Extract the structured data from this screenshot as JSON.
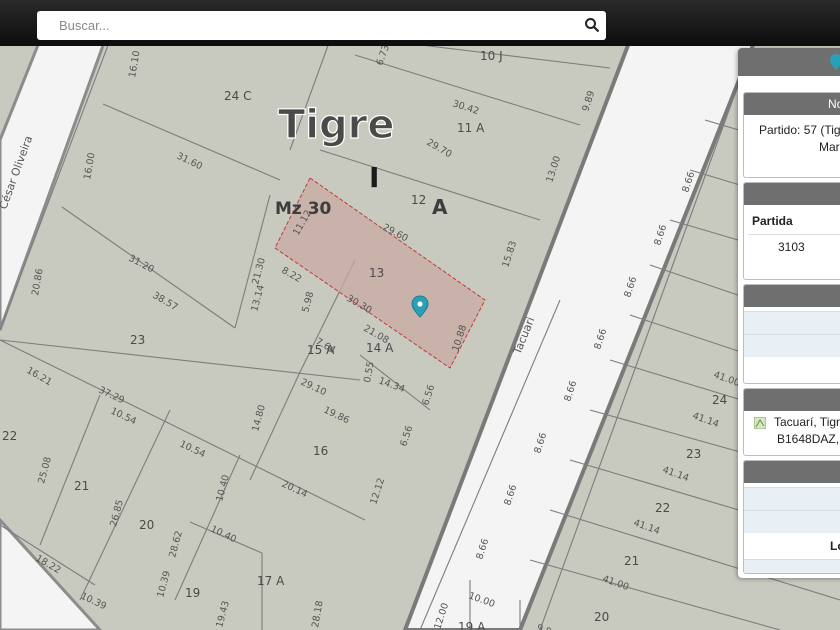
{
  "search": {
    "placeholder": "Buscar..."
  },
  "map": {
    "town": "Tigre",
    "section": "I",
    "block": "Mz 30",
    "parcel_letter": "A",
    "streets": [
      "Tacuarí",
      "Tacuari",
      "César Oliveira",
      "Tac"
    ],
    "lots": [
      "24 C",
      "10 J",
      "11 A",
      "12",
      "13",
      "14 A",
      "15 A",
      "23",
      "16",
      "21",
      "20",
      "22",
      "19",
      "17 A",
      "24",
      "23",
      "22",
      "21",
      "20",
      "19 A"
    ],
    "dimensions": [
      "16.10",
      "6.73",
      "9.89",
      "30.42",
      "29.70",
      "13.00",
      "31.60",
      "16.00",
      "11.12",
      "29.60",
      "15.83",
      "21.30",
      "8.22",
      "31.20",
      "38.57",
      "13.14",
      "5.98",
      "30.30",
      "21.08",
      "10.88",
      "7.64",
      "0.55",
      "14.34",
      "6.56",
      "20.86",
      "16.21",
      "37.29",
      "10.54",
      "29.10",
      "19.86",
      "14.80",
      "6.56",
      "10.54",
      "25.08",
      "26.85",
      "10.40",
      "20.14",
      "12.12",
      "28.62",
      "10.40",
      "18.22",
      "10.39",
      "10.39",
      "19.43",
      "28.18",
      "8.66",
      "8.66",
      "8.66",
      "8.66",
      "8.66",
      "8.66",
      "8.66",
      "41.00",
      "41.14",
      "41.14",
      "41.14",
      "41.00",
      "8.66",
      "10.00",
      "9.9",
      "12.00"
    ]
  },
  "panel": {
    "header_partial": "No",
    "partido_text": "Partido: 57 (Tig",
    "partido_text2": "Mar",
    "table_col": "Partida",
    "table_val": "3103",
    "address_line1": "Tacuarí, Tigr",
    "address_line2": "B1648DAZ,",
    "bottom_label": "Lo"
  },
  "colors": {
    "parcel_highlight": "#c9a9a2",
    "marker": "#2aa0b8",
    "street": "#f4f4f4"
  }
}
